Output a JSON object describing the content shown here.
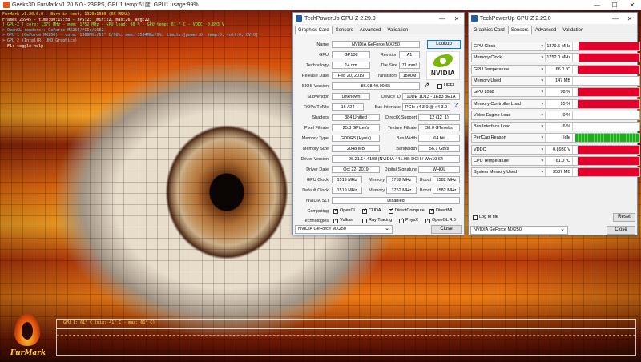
{
  "furmark": {
    "title": "Geeks3D FurMark v1.20.6.0 - 23FPS, GPU1 temp:61度, GPU1 usage:99%",
    "logo_text": "FurMark",
    "osd": [
      "FurMark v1.20.6.0 - Burn-in test, 1920x1080 (0X MSAA)",
      "Frames:26945 - time:00:19:58 - FPS:23 (min:22, max:26, avg:22)",
      "[ GPU-Z ] core: 1379 MHz - mem: 1752 MHz - GPU load: 98 % - GPU temp: 61 ° C - VDDC: 0.893 V",
      "> OpenGL renderer: GeForce MX250/PCIe/SSE2",
      "> GPU 1 (GeForce MX250) - core: 1366MHz/61° C/98%, mem: 3504MHz/0%, limits:[power:0, temp:0, volt:0, OV:0]",
      "> GPU 2 (Intel(R) UHD Graphics)",
      "- F1: toggle help"
    ],
    "graph_label": "GPU 1: 61° C (min: 41° C - max: 61° C)"
  },
  "gpuz1": {
    "title": "TechPowerUp GPU-Z 2.29.0",
    "tabs": [
      {
        "label": "Graphics Card",
        "active": true
      },
      {
        "label": "Sensors",
        "active": false
      },
      {
        "label": "Advanced",
        "active": false
      },
      {
        "label": "Validation",
        "active": false
      }
    ],
    "lookup": "Lookup",
    "uefi": "UEFI",
    "close": "Close",
    "model": "NVIDIA GeForce MX250",
    "vendor_logo": "NVIDIA",
    "fields": {
      "name_l": "Name",
      "name": "NVIDIA GeForce MX250",
      "gpu_l": "GPU",
      "gpu": "GP108",
      "rev_l": "Revision",
      "rev": "A1",
      "tech_l": "Technology",
      "tech": "14 nm",
      "die_l": "Die Size",
      "die": "71 mm²",
      "rel_l": "Release Date",
      "rel": "Feb 20, 2019",
      "tr_l": "Transistors",
      "tr": "1800M",
      "bios_l": "BIOS Version",
      "bios": "86.08.40.00.55",
      "sub_l": "Subvendor",
      "sub": "Unknown",
      "dev_l": "Device ID",
      "dev": "10DE 1D13 - 1E83 3E1A",
      "rops_l": "ROPs/TMUs",
      "rops": "16 / 24",
      "bus_l": "Bus Interface",
      "bus": "PCIe x4 3.0 @ x4 3.0",
      "q": "?",
      "sh_l": "Shaders",
      "sh": "384 Unified",
      "dx_l": "DirectX Support",
      "dx": "12 (12_1)",
      "pf_l": "Pixel Fillrate",
      "pf": "25.3 GPixel/s",
      "tf_l": "Texture Fillrate",
      "tf": "38.0 GTexel/s",
      "mt_l": "Memory Type",
      "mt": "GDDR5 (Hynix)",
      "bw_l": "Bus Width",
      "bw": "64 bit",
      "ms_l": "Memory Size",
      "ms": "2048 MB",
      "band_l": "Bandwidth",
      "band": "56.1 GB/s",
      "dv_l": "Driver Version",
      "dv": "26.21.14.4108 (NVIDIA 441.08) DCH / Win10 64",
      "dd_l": "Driver Date",
      "dd": "Oct 22, 2019",
      "ds_l": "Digital Signature",
      "ds": "WHQL",
      "gc_l": "GPU Clock",
      "gc": "1519 MHz",
      "mem_l": "Memory",
      "mem": "1752 MHz",
      "boost_l": "Boost",
      "boost": "1582 MHz",
      "dc_l": "Default Clock",
      "dc": "1519 MHz",
      "mem2": "1752 MHz",
      "boost2": "1582 MHz",
      "sli_l": "NVIDIA SLI",
      "sli": "Disabled",
      "comp_l": "Computing",
      "tech2_l": "Technologies"
    },
    "computing": [
      "OpenCL",
      "CUDA",
      "DirectCompute",
      "DirectML"
    ],
    "technologies": [
      "Vulkan",
      "Ray Tracing",
      "PhysX",
      "OpenGL 4.6"
    ],
    "tech_checked": [
      true,
      false,
      true,
      true
    ]
  },
  "gpuz2": {
    "title": "TechPowerUp GPU-Z 2.29.0",
    "tabs": [
      {
        "label": "Graphics Card",
        "active": false
      },
      {
        "label": "Sensors",
        "active": true
      },
      {
        "label": "Advanced",
        "active": false
      },
      {
        "label": "Validation",
        "active": false
      }
    ],
    "sensors": [
      {
        "label": "GPU Clock",
        "value": "1379.5 MHz",
        "level": 0.92,
        "kind": "red"
      },
      {
        "label": "Memory Clock",
        "value": "1752.0 MHz",
        "level": 0.92,
        "kind": "red"
      },
      {
        "label": "GPU Temperature",
        "value": "66.0 °C",
        "level": 0.93,
        "kind": "red"
      },
      {
        "label": "Memory Used",
        "value": "147 MB",
        "level": 0,
        "kind": "red"
      },
      {
        "label": "GPU Load",
        "value": "98 %",
        "level": 0.93,
        "kind": "red"
      },
      {
        "label": "Memory Controller Load",
        "value": "95 %",
        "level": 0.93,
        "kind": "red"
      },
      {
        "label": "Video Engine Load",
        "value": "0 %",
        "level": 0,
        "kind": "red"
      },
      {
        "label": "Bus Interface Load",
        "value": "6 %",
        "level": 0,
        "kind": "red"
      },
      {
        "label": "PerfCap Reason",
        "value": "Idle",
        "level": 0.96,
        "kind": "green"
      },
      {
        "label": "VDDC",
        "value": "0.8930 V",
        "level": 0.93,
        "kind": "red"
      },
      {
        "label": "CPU Temperature",
        "value": "61.0 °C",
        "level": 0.93,
        "kind": "red"
      },
      {
        "label": "System Memory Used",
        "value": "3537 MB",
        "level": 0.93,
        "kind": "red"
      }
    ],
    "log": "Log to file",
    "reset": "Reset",
    "close": "Close",
    "model": "NVIDIA GeForce MX250"
  }
}
